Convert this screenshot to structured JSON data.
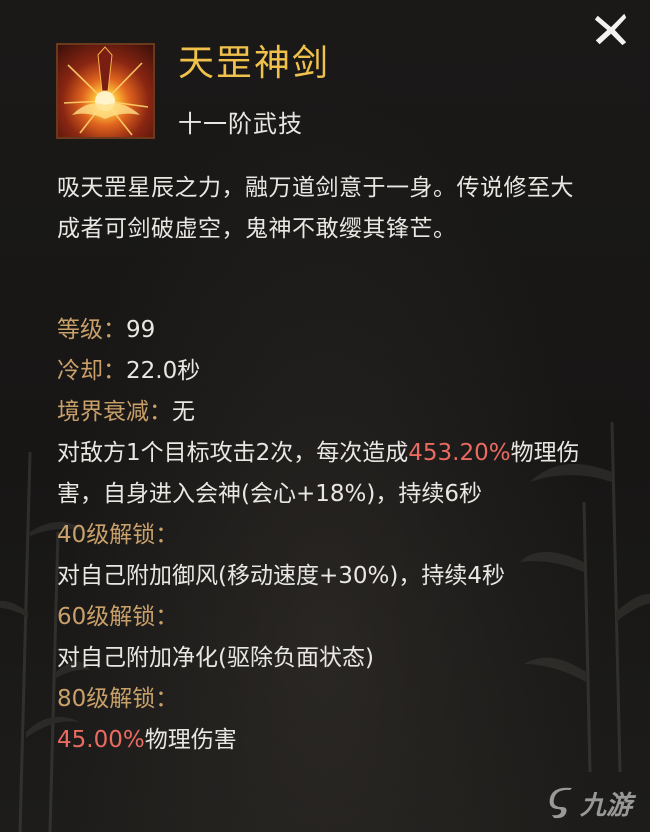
{
  "skill": {
    "icon": "flaming-sword-skill-icon",
    "title": "天罡神剑",
    "rank": "十一阶武技",
    "description": "吸天罡星辰之力，融万道剑意于一身。传说修至大成者可剑破虚空，鬼神不敢缨其锋芒。"
  },
  "stats": {
    "level_label": "等级：",
    "level_value": "99",
    "cooldown_label": "冷却：",
    "cooldown_value": "22.0秒",
    "realm_decay_label": "境界衰减：",
    "realm_decay_value": "无"
  },
  "effect": {
    "part1": "对敌方1个目标攻击2次，每次造成",
    "damage_percent": "453.20%",
    "part2": "物理伤害，自身进入会神(会心+18%)，持续6秒"
  },
  "unlocks": [
    {
      "header": "40级解锁：",
      "pre": "对自己附加御风(移动速度+30%)，持续4秒",
      "highlight": "",
      "post": ""
    },
    {
      "header": "60级解锁：",
      "pre": "对自己附加净化(驱除负面状态)",
      "highlight": "",
      "post": ""
    },
    {
      "header": "80级解锁：",
      "pre": "",
      "highlight": "45.00%",
      "post": "物理伤害"
    }
  ],
  "watermark": {
    "text": "九游",
    "icon": "jiuyou-logo-icon"
  },
  "colors": {
    "title": "#f0c24c",
    "label": "#c9a06a",
    "highlight": "#e96b61",
    "text": "#e9e7e3",
    "background": "#171615"
  }
}
